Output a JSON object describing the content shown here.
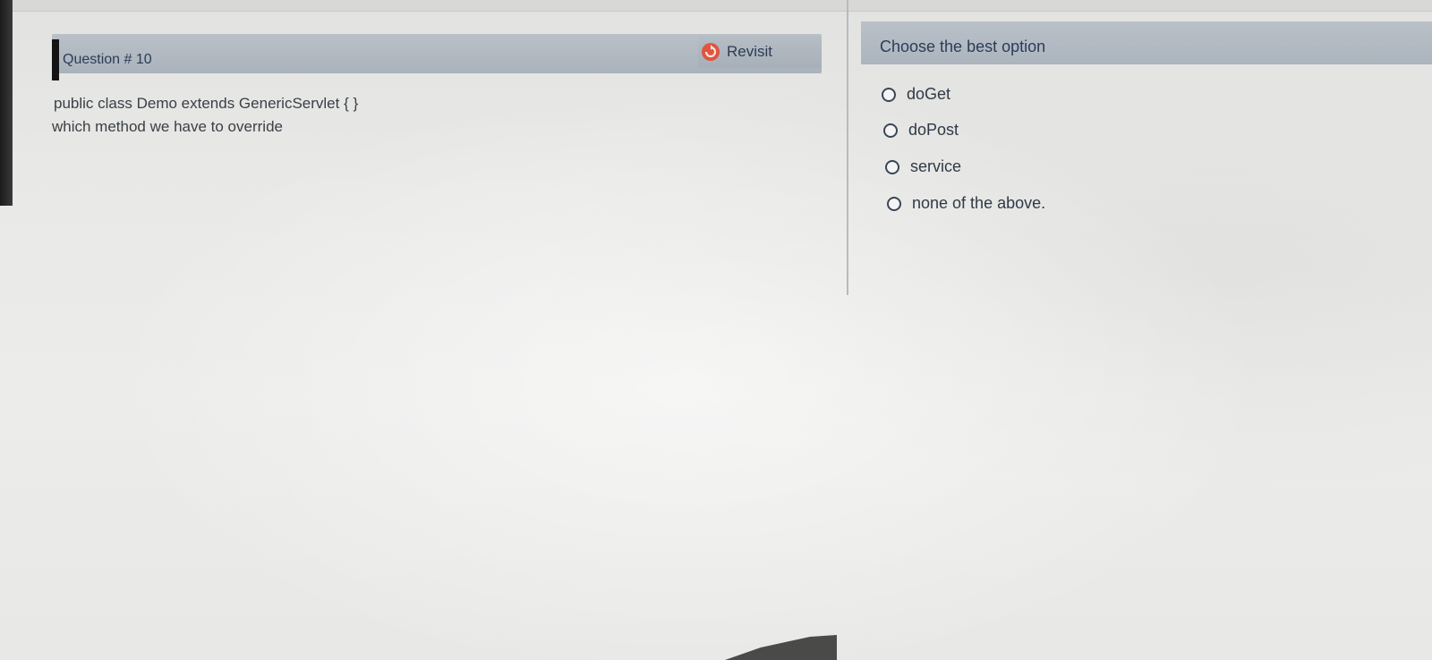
{
  "question": {
    "title": "Question # 10",
    "lines": [
      "public class Demo extends GenericServlet {   }",
      "which method we have to override"
    ],
    "revisit_label": "Revisit"
  },
  "options_panel": {
    "title": "Choose the best option",
    "options": [
      {
        "label": "doGet",
        "selected": false
      },
      {
        "label": "doPost",
        "selected": false
      },
      {
        "label": "service",
        "selected": false
      },
      {
        "label": "none of the above.",
        "selected": false
      }
    ]
  },
  "colors": {
    "header_bar": "#aab2bb",
    "header_text": "#2a3d57",
    "revisit_icon": "#e0553f"
  },
  "icons": {
    "revisit": "revisit-icon",
    "radio": "radio-icon"
  }
}
